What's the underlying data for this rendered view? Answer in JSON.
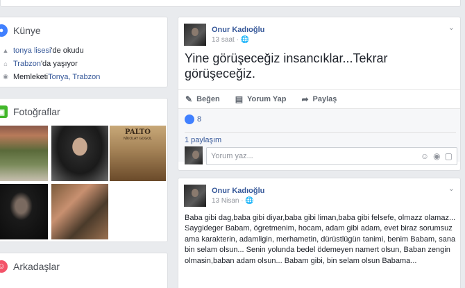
{
  "left_column": {
    "intro": {
      "title": "Künye",
      "items": [
        {
          "link": "tonya lisesi",
          "suffix": "'de okudu"
        },
        {
          "link": "Trabzon",
          "suffix": "'da yaşıyor"
        },
        {
          "prefix": "Memleketi ",
          "link": "Tonya, Trabzon"
        }
      ]
    },
    "photos": {
      "title": "Fotoğraflar",
      "book_cover_title": "PALTO",
      "book_cover_author": "NİKOLAY GOGOL"
    },
    "friends": {
      "title": "Arkadaşlar"
    }
  },
  "posts": [
    {
      "author": "Onur Kadıoğlu",
      "time": "13 saat",
      "privacy": "globe-icon",
      "text": "Yine görüşeceğiz insancıklar...Tekrar görüşeceğiz.",
      "actions": {
        "like": "Beğen",
        "comment": "Yorum Yap",
        "share": "Paylaş"
      },
      "reactions_count": "8",
      "shares": "1 paylaşım",
      "comment_placeholder": "Yorum yaz..."
    },
    {
      "author": "Onur Kadıoğlu",
      "time": "13 Nisan",
      "privacy": "globe-icon",
      "text": "Baba gibi dag,baba gibi diyar,baba gibi liman,baba gibi felsefe, olmazz olamaz... Saygideger Babam, ögretmenim, hocam, adam gibi adam, evet biraz sorumsuz ama karakterin, adamligin, merhametin, dürüstlügün tanimi, benim Babam, sana bin selam olsun... Senin yolunda bedel ödemeyen namert olsun, Baban zengin olmasin,baban adam olsun... Babam gibi, bin selam olsun Babama..."
    }
  ],
  "colors": {
    "link": "#365899",
    "intro_icon": "#4080ff",
    "photos_icon": "#42b72a",
    "friends_icon": "#f35369"
  }
}
